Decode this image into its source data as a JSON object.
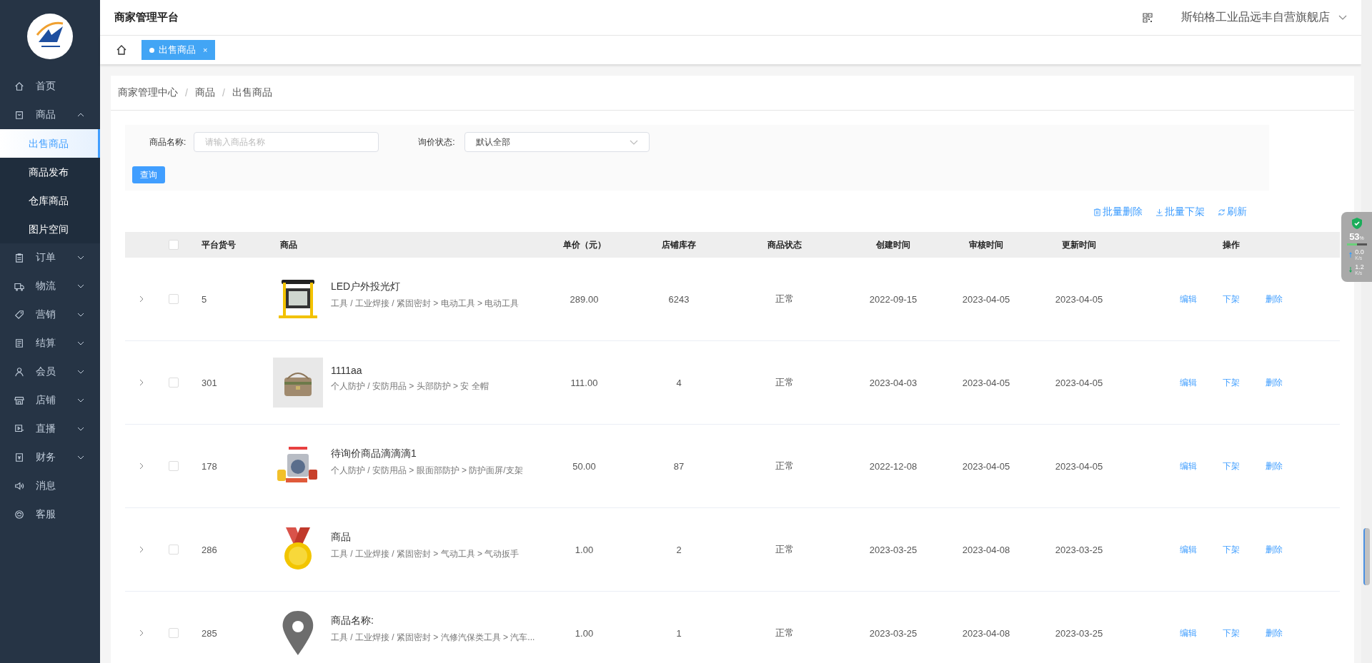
{
  "sidebar": {
    "items": [
      {
        "label": "首页",
        "selected": false
      },
      {
        "label": "商品",
        "selected": false,
        "expanded": true,
        "children": [
          {
            "label": "出售商品",
            "selected": true
          },
          {
            "label": "商品发布",
            "selected": false
          },
          {
            "label": "仓库商品",
            "selected": false
          },
          {
            "label": "图片空间",
            "selected": false
          }
        ]
      },
      {
        "label": "订单",
        "selected": false,
        "expanded": false
      },
      {
        "label": "物流",
        "selected": false,
        "expanded": false
      },
      {
        "label": "营销",
        "selected": false,
        "expanded": false
      },
      {
        "label": "结算",
        "selected": false,
        "expanded": false
      },
      {
        "label": "会员",
        "selected": false,
        "expanded": false
      },
      {
        "label": "店铺",
        "selected": false,
        "expanded": false
      },
      {
        "label": "直播",
        "selected": false,
        "expanded": false
      },
      {
        "label": "财务",
        "selected": false,
        "expanded": false
      },
      {
        "label": "消息",
        "selected": false
      },
      {
        "label": "客服",
        "selected": false
      }
    ]
  },
  "header": {
    "title": "商家管理平台",
    "store_name": "斯铂格工业品远丰自营旗舰店"
  },
  "tabs": [
    {
      "label": "出售商品",
      "selected": true,
      "close": "×"
    }
  ],
  "breadcrumb": [
    "商家管理中心",
    "/",
    "商品",
    "/",
    "出售商品"
  ],
  "filters": {
    "name_label": "商品名称:",
    "name_placeholder": "请输入商品名称",
    "status_label": "询价状态:",
    "status_value": "默认全部",
    "query_button": "查询"
  },
  "toolbar": [
    "批量删除",
    "批量下架",
    "刷新"
  ],
  "table": {
    "select_all_checked": false,
    "columns": [
      "平台货号",
      "商品",
      "单价（元）",
      "店铺库存",
      "商品状态",
      "创建时间",
      "审核时间",
      "更新时间",
      "操作"
    ],
    "rows": [
      {
        "expanded": false,
        "checked": false,
        "id": "5",
        "name": "LED户外投光灯",
        "category": "工具 / 工业焊接 / 紧固密封 > 电动工具 > 电动工具",
        "price": "289.00",
        "stock": "6243",
        "status": "正常",
        "created": "2022-09-15",
        "audited": "2023-04-05",
        "updated": "2023-04-05",
        "actions": [
          "编辑",
          "下架",
          "删除"
        ]
      },
      {
        "expanded": false,
        "checked": false,
        "id": "301",
        "name": "1111aa",
        "category": "个人防护 / 安防用品 > 头部防护 > 安 全帽",
        "price": "111.00",
        "stock": "4",
        "status": "正常",
        "created": "2023-04-03",
        "audited": "2023-04-05",
        "updated": "2023-04-05",
        "actions": [
          "编辑",
          "下架",
          "删除"
        ]
      },
      {
        "expanded": false,
        "checked": false,
        "id": "178",
        "name": "待询价商品滴滴滴1",
        "category": "个人防护 / 安防用品 > 眼面部防护 > 防护面屏/支架",
        "price": "50.00",
        "stock": "87",
        "status": "正常",
        "created": "2022-12-08",
        "audited": "2023-04-05",
        "updated": "2023-04-05",
        "actions": [
          "编辑",
          "下架",
          "删除"
        ]
      },
      {
        "expanded": false,
        "checked": false,
        "id": "286",
        "name": "商品",
        "category": "工具 / 工业焊接 / 紧固密封 > 气动工具 > 气动扳手",
        "price": "1.00",
        "stock": "2",
        "status": "正常",
        "created": "2023-03-25",
        "audited": "2023-04-08",
        "updated": "2023-03-25",
        "actions": [
          "编辑",
          "下架",
          "删除"
        ]
      },
      {
        "expanded": false,
        "checked": false,
        "id": "285",
        "name": "商品名称:",
        "category": "工具 / 工业焊接 / 紧固密封 > 汽修汽保类工具 > 汽车...",
        "price": "1.00",
        "stock": "1",
        "status": "正常",
        "created": "2023-03-25",
        "audited": "2023-04-08",
        "updated": "2023-03-25",
        "actions": [
          "编辑",
          "下架",
          "删除"
        ]
      }
    ]
  },
  "speed_widget": {
    "percent": "53",
    "percent_unit": "%",
    "level": 0.53,
    "upload": "0.0",
    "upload_unit": "K/s",
    "download": "1.2",
    "download_unit": "K/s"
  }
}
